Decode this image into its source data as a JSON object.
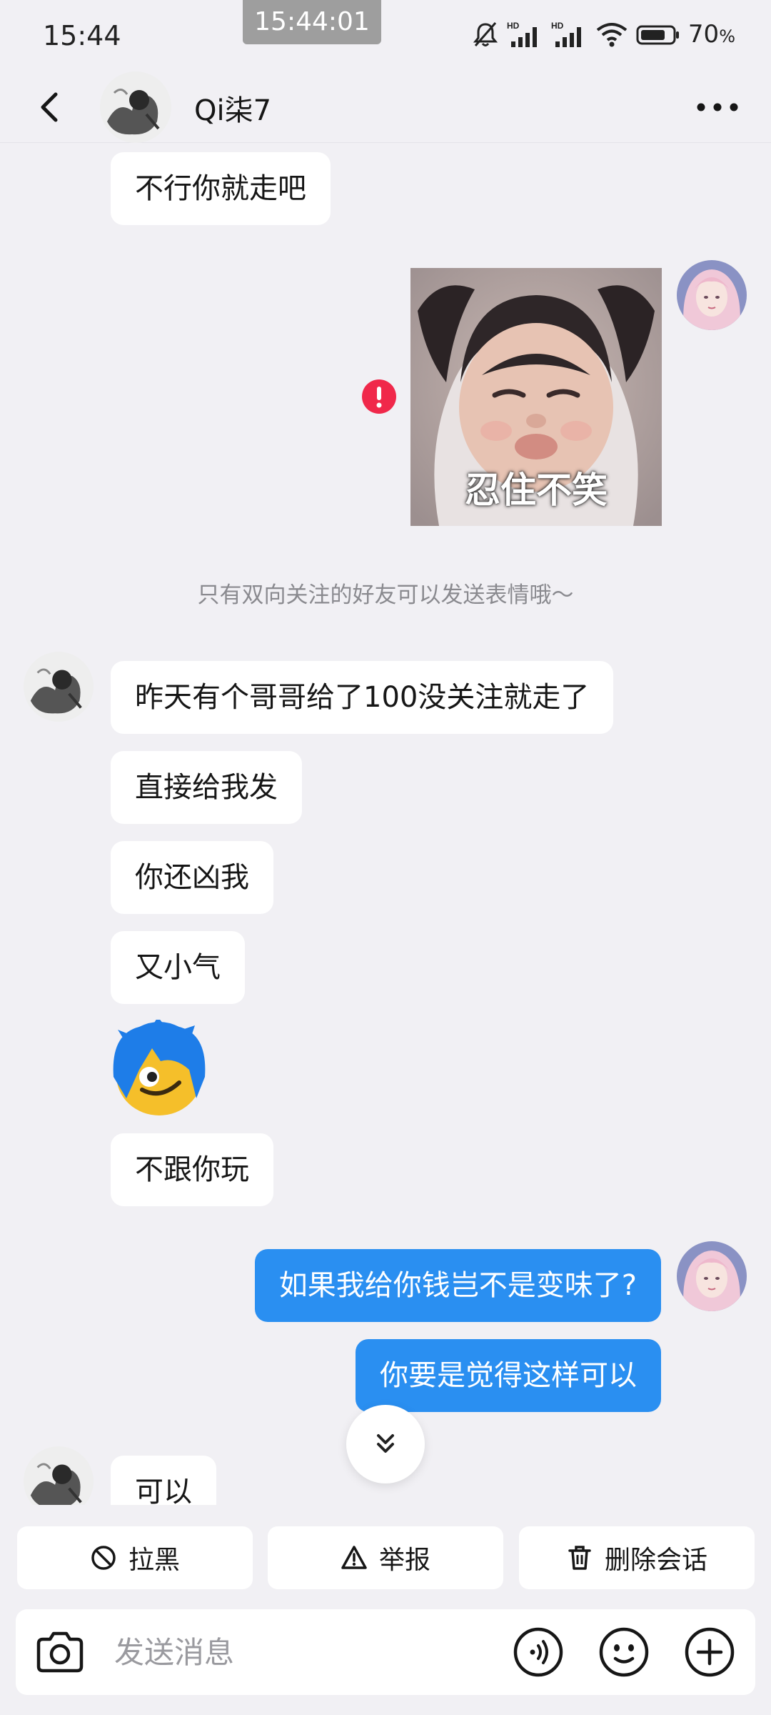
{
  "status_bar": {
    "time": "15:44",
    "overlay_clock": "15:44:01",
    "battery_percent": "70",
    "battery_unit": "%",
    "network_labels": [
      "HD",
      "HD"
    ]
  },
  "header": {
    "contact_name": "Qi柒7"
  },
  "messages": {
    "m1": "不行你就走吧",
    "sticker_caption": "忍住不笑",
    "system_note": "只有双向关注的好友可以发送表情哦～",
    "m2": "昨天有个哥哥给了100没关注就走了",
    "m3": "直接给我发",
    "m4": "你还凶我",
    "m5": "又小气",
    "m6": "不跟你玩",
    "m7": "如果我给你钱岂不是变味了?",
    "m8": "你要是觉得这样可以",
    "m9": "可以"
  },
  "actions": {
    "block": "拉黑",
    "report": "举报",
    "delete": "删除会话"
  },
  "input": {
    "placeholder": "发送消息"
  },
  "colors": {
    "outgoing_bubble": "#2a8ff1",
    "background": "#f1f0f4",
    "error": "#f0284a"
  }
}
